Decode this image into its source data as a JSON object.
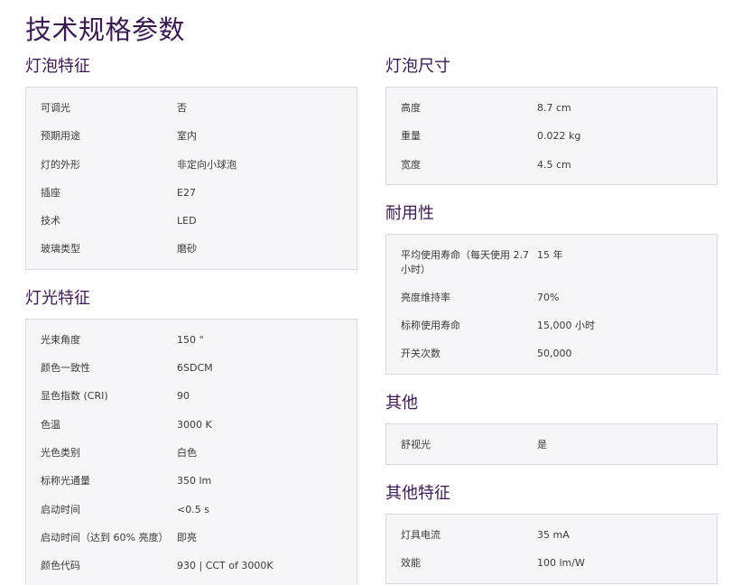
{
  "page_title": "技术规格参数",
  "left_sections": [
    {
      "title": "灯泡特征",
      "rows": [
        {
          "label": "可调光",
          "value": "否"
        },
        {
          "label": "预期用途",
          "value": "室内"
        },
        {
          "label": "灯的外形",
          "value": "非定向小球泡"
        },
        {
          "label": "插座",
          "value": "E27"
        },
        {
          "label": "技术",
          "value": "LED"
        },
        {
          "label": "玻璃类型",
          "value": "磨砂"
        }
      ]
    },
    {
      "title": "灯光特征",
      "rows": [
        {
          "label": "光束角度",
          "value": "150 °"
        },
        {
          "label": "颜色一致性",
          "value": "6SDCM"
        },
        {
          "label": "显色指数 (CRI)",
          "value": "90"
        },
        {
          "label": "色温",
          "value": "3000 K"
        },
        {
          "label": "光色类别",
          "value": "白色"
        },
        {
          "label": "标称光通量",
          "value": "350 lm"
        },
        {
          "label": "启动时间",
          "value": "<0.5 s"
        },
        {
          "label": "启动时间（达到 60% 亮度）",
          "value": "即亮"
        },
        {
          "label": "颜色代码",
          "value": "930 | CCT of 3000K"
        }
      ]
    }
  ],
  "right_sections": [
    {
      "title": "灯泡尺寸",
      "rows": [
        {
          "label": "高度",
          "value": "8.7 cm"
        },
        {
          "label": "重量",
          "value": "0.022 kg"
        },
        {
          "label": "宽度",
          "value": "4.5 cm"
        }
      ]
    },
    {
      "title": "耐用性",
      "rows": [
        {
          "label": "平均使用寿命（每天使用 2.7 小时）",
          "value": "15 年"
        },
        {
          "label": "亮度维持率",
          "value": "70%"
        },
        {
          "label": "标称使用寿命",
          "value": "15,000 小时"
        },
        {
          "label": "开关次数",
          "value": "50,000"
        }
      ]
    },
    {
      "title": "其他",
      "rows": [
        {
          "label": "舒视光",
          "value": "是"
        }
      ]
    },
    {
      "title": "其他特征",
      "rows": [
        {
          "label": "灯具电流",
          "value": "35 mA"
        },
        {
          "label": "效能",
          "value": "100 lm/W"
        }
      ]
    }
  ]
}
